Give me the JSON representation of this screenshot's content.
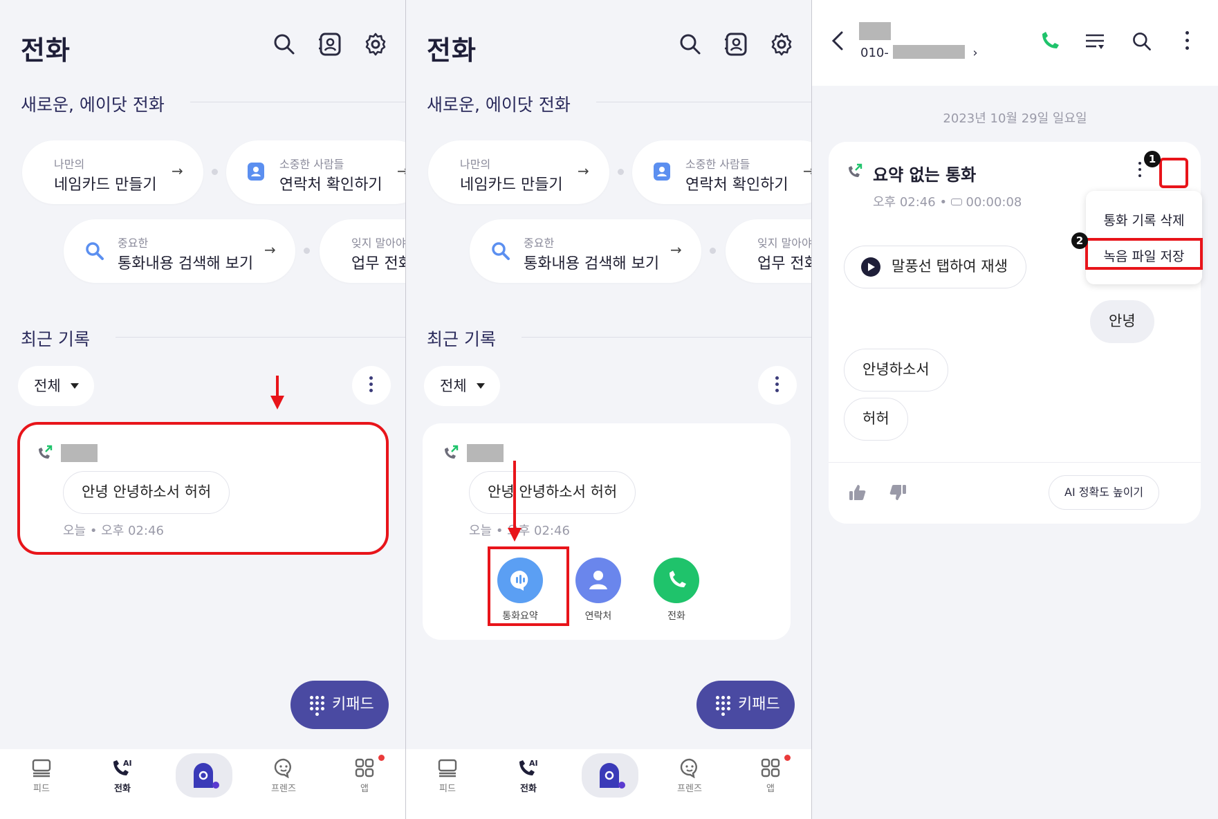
{
  "panel1": {
    "title": "전화",
    "section_new": "새로운, 에이닷 전화",
    "chips": [
      {
        "sub": "나만의",
        "main": "네임카드 만들기"
      },
      {
        "sub": "소중한 사람들",
        "main": "연락처 확인하기"
      },
      {
        "sub": "중요한",
        "main": "통화내용 검색해 보기"
      },
      {
        "sub": "잊지 말아야",
        "main": "업무 전화"
      }
    ],
    "section_recent": "최근 기록",
    "filter": "전체",
    "call": {
      "bubble": "안녕 안녕하소서 허허",
      "meta": "오늘 • 오후 02:46"
    },
    "keypad": "키패드",
    "tabs": [
      "피드",
      "전화",
      "프렌즈",
      "앱"
    ],
    "ai_badge": "AI"
  },
  "panel2": {
    "title": "전화",
    "section_new": "새로운, 에이닷 전화",
    "chips": [
      {
        "sub": "나만의",
        "main": "네임카드 만들기"
      },
      {
        "sub": "소중한 사람들",
        "main": "연락처 확인하기"
      },
      {
        "sub": "중요한",
        "main": "통화내용 검색해 보기"
      },
      {
        "sub": "잊지 말아야",
        "main": "업무 전화"
      }
    ],
    "section_recent": "최근 기록",
    "filter": "전체",
    "call": {
      "bubble": "안녕 안녕하소서 허허",
      "meta": "오늘 • 오후 02:46"
    },
    "actions": [
      "통화요약",
      "연락처",
      "전화"
    ],
    "keypad": "키패드",
    "tabs": [
      "피드",
      "전화",
      "프렌즈",
      "앱"
    ],
    "ai_badge": "AI"
  },
  "panel3": {
    "number_prefix": "010-",
    "chevron": "›",
    "date": "2023년 10월 29일 일요일",
    "card_title": "요약 없는 통화",
    "time": "오후 02:46",
    "duration": "00:00:08",
    "play_label": "말풍선 탭하여 재생",
    "bubbles_right": [
      "안녕"
    ],
    "bubbles_left": [
      "안녕하소서",
      "허허"
    ],
    "improve": "AI 정확도 높이기",
    "menu": [
      "통화 기록 삭제",
      "녹음 파일 저장"
    ],
    "badges": [
      "1",
      "2"
    ]
  },
  "colors": {
    "accent": "#4a4aa2",
    "annotation": "#e8141a",
    "green": "#1fc36b",
    "blue": "#5b8ff0"
  }
}
